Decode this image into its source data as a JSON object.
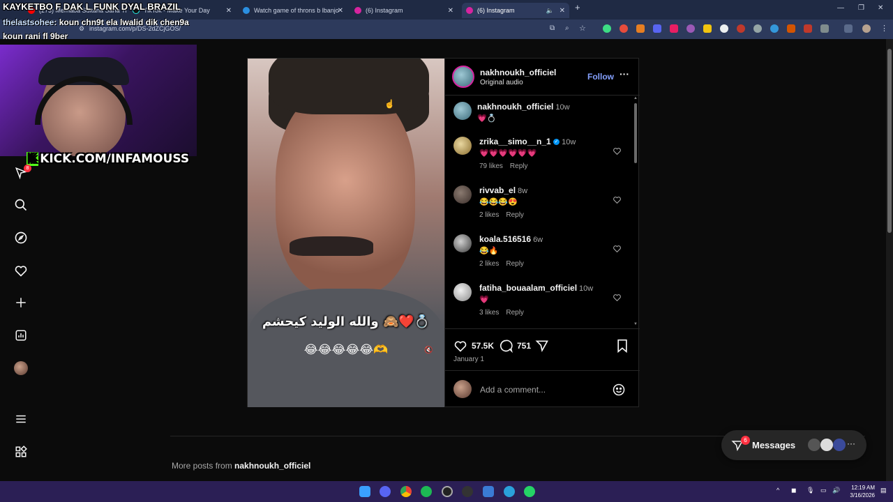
{
  "browser": {
    "tabs": [
      {
        "label": "(273) Merhaba Sultana Sana Yi",
        "active": false
      },
      {
        "label": "TikTok - Make Your Day",
        "active": false
      },
      {
        "label": "Watch game of throns b lbanjo",
        "active": false
      },
      {
        "label": "(6) Instagram",
        "active": false
      },
      {
        "label": "(6) Instagram",
        "active": true
      }
    ],
    "url": "instagram.com/p/DS-2dZCjGOS/"
  },
  "overlay": {
    "title": "KAYKETBO F DAK L FUNK DYAL BRAZIL",
    "chat_user": "thelastsohee",
    "chat_msg": ": koun chn9t ela lwalid dik chen9a",
    "chat_line2": "koun rani fl 9ber",
    "kick_k": "K",
    "kick_label": "KICK.COM/INFAMOUSS"
  },
  "nav": {
    "notifications_badge": "8"
  },
  "post": {
    "author": "nakhnoukh_officiel",
    "audio": "Original audio",
    "follow_label": "Follow",
    "more_label": "···",
    "video_caption_line1": "والله الوليد كيحشم 🙈❤️💍",
    "video_caption_line2": "😂😂😂😂😂🫶",
    "likes": "57.5K",
    "comments_count": "751",
    "date": "January 1",
    "add_comment_placeholder": "Add a comment...",
    "comments": [
      {
        "user": "nakhnoukh_officiel",
        "time": "10w",
        "text": "💗💍",
        "likes": "",
        "reply": "",
        "verified": false
      },
      {
        "user": "zrika__simo__n_1",
        "time": "10w",
        "text": "💗💗💗💗💗💗",
        "likes": "79 likes",
        "reply": "Reply",
        "verified": true
      },
      {
        "user": "rivvab_el",
        "time": "8w",
        "text": "😂😂😂😍",
        "likes": "2 likes",
        "reply": "Reply",
        "verified": false
      },
      {
        "user": "koala.516516",
        "time": "6w",
        "text": "😂🔥",
        "likes": "2 likes",
        "reply": "Reply",
        "verified": false
      },
      {
        "user": "fatiha_bouaalam_officiel",
        "time": "10w",
        "text": "💗",
        "likes": "3 likes",
        "reply": "Reply",
        "verified": false
      }
    ]
  },
  "more_posts": {
    "prefix": "More posts from",
    "user": "nakhnoukh_officiel"
  },
  "messages": {
    "label": "Messages",
    "badge": "6"
  },
  "taskbar": {
    "time": "12:19 AM",
    "date": "3/16/2026"
  },
  "colors": {
    "accent_link": "#85a1ff",
    "badge_red": "#ff3040",
    "kick_green": "#53fc18"
  }
}
